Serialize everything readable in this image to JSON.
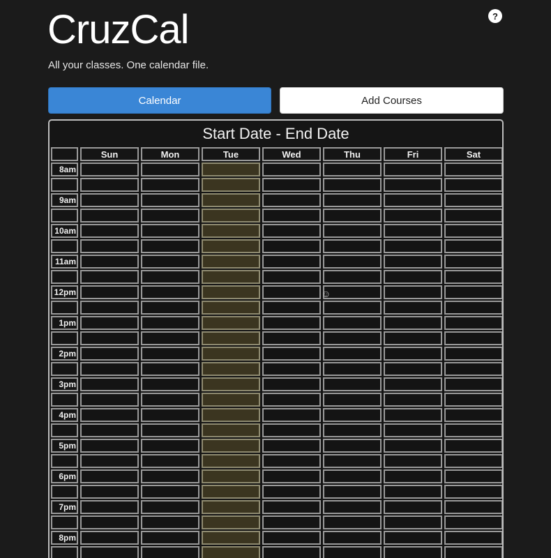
{
  "app": {
    "title": "CruzCal",
    "tagline": "All your classes. One calendar file.",
    "help_label": "?"
  },
  "tabs": [
    {
      "label": "Calendar",
      "active": true
    },
    {
      "label": "Add Courses",
      "active": false
    }
  ],
  "calendar": {
    "title": "Start Date - End Date",
    "days": [
      "Sun",
      "Mon",
      "Tue",
      "Wed",
      "Thu",
      "Fri",
      "Sat"
    ],
    "highlighted_day": "Tue",
    "hours": [
      "8am",
      "9am",
      "10am",
      "11am",
      "12pm",
      "1pm",
      "2pm",
      "3pm",
      "4pm",
      "5pm",
      "6pm",
      "7pm",
      "8pm"
    ]
  },
  "colors": {
    "background": "#1b1b1b",
    "accent": "#3a86d6",
    "today_highlight": "#3b3520"
  }
}
